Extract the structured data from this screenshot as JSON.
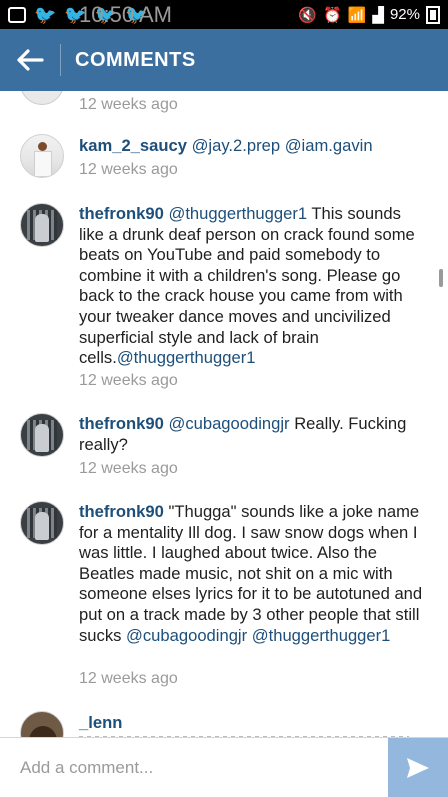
{
  "status_bar": {
    "battery": "92%",
    "time": "10:50 AM",
    "icons": [
      "plus-square-icon",
      "twitter-icon",
      "twitter-icon",
      "twitter-icon",
      "twitter-icon",
      "mute-icon",
      "alarm-icon",
      "wifi-icon",
      "signal-icon",
      "battery-icon"
    ]
  },
  "app_bar": {
    "title": "COMMENTS",
    "back_icon": "arrow-left-icon",
    "color": "#3b6fa0"
  },
  "comments": [
    {
      "time": "12 weeks ago"
    },
    {
      "user": "kam_2_saucy",
      "pre": "",
      "mentions": [
        "@jay.2.prep",
        "@iam.gavin"
      ],
      "text": "",
      "time": "12 weeks ago"
    },
    {
      "user": "thefronk90",
      "m1": "@thuggerthugger1",
      "text": " This sounds like a drunk deaf person on crack found some beats on YouTube and paid somebody to combine it with a children's song. Please go back to the crack house you came from with your tweaker dance moves and uncivilized superficial style and lack of brain cells.",
      "m2": "@thuggerthugger1",
      "time": "12 weeks ago"
    },
    {
      "user": "thefronk90",
      "m1": "@cubagoodingjr",
      "text": " Really. Fucking really?",
      "time": "12 weeks ago"
    },
    {
      "user": "thefronk90",
      "text": " \"Thugga\" sounds like a joke name for a mentality Ill dog. I saw snow dogs when I was little. I laughed about twice. Also the Beatles made music, not shit on a mic with someone elses lyrics for it to be autotuned and put on a track made by 3 other people that still sucks ",
      "m1": "@cubagoodingjr",
      "m2": "@thuggerthugger1",
      "time": "12 weeks ago"
    },
    {
      "user": "_lenn"
    }
  ],
  "input": {
    "placeholder": "Add a comment...",
    "send_icon": "send-arrow-icon",
    "send_color": "#93b7dd"
  }
}
